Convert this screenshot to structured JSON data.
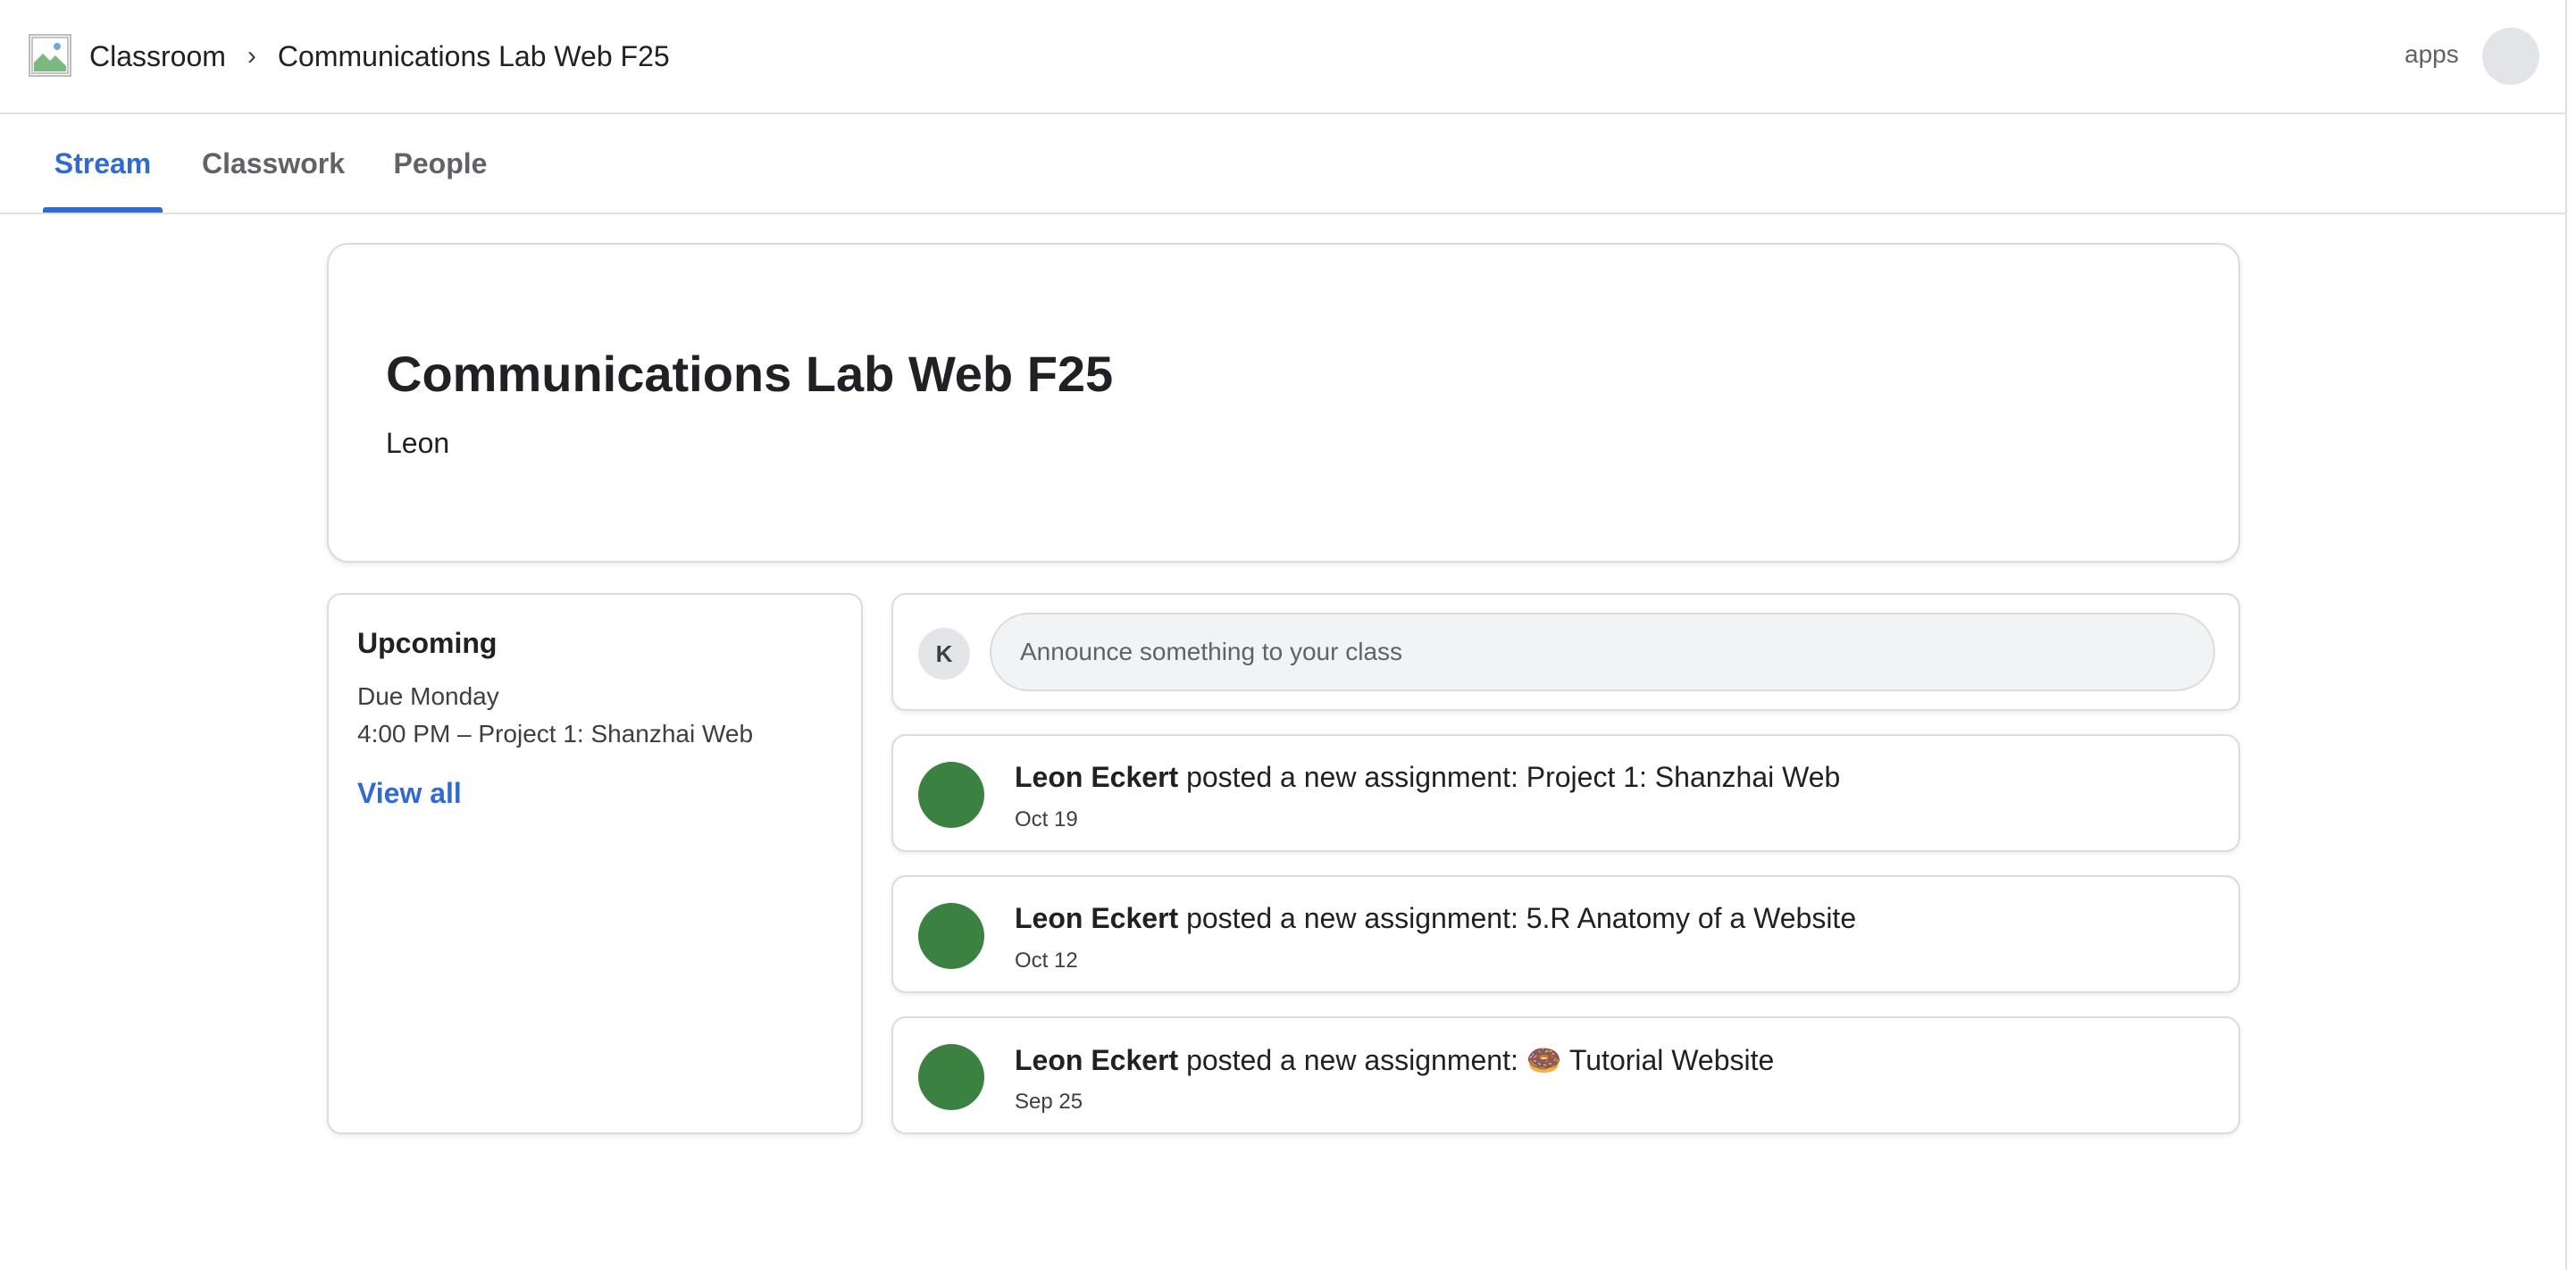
{
  "header": {
    "logo_alt": "",
    "breadcrumb_root": "Classroom",
    "breadcrumb_separator": "›",
    "breadcrumb_current": "Communications Lab Web F25",
    "apps_label": "apps"
  },
  "tabs": [
    {
      "label": "Stream",
      "active": true
    },
    {
      "label": "Classwork",
      "active": false
    },
    {
      "label": "People",
      "active": false
    }
  ],
  "banner": {
    "title": "Communications Lab Web F25",
    "subtitle": "Leon"
  },
  "upcoming": {
    "title": "Upcoming",
    "due_label": "Due Monday",
    "item": "4:00 PM – Project 1: Shanzhai Web",
    "view_all": "View all"
  },
  "announce": {
    "avatar_initial": "K",
    "placeholder": "Announce something to your class"
  },
  "posts": [
    {
      "author": "Leon Eckert",
      "text": " posted a new assignment: Project 1: Shanzhai Web",
      "date": "Oct 19"
    },
    {
      "author": "Leon Eckert",
      "text": " posted a new assignment: 5.R Anatomy of a Website",
      "date": "Oct 12"
    },
    {
      "author": "Leon Eckert",
      "text": " posted a new assignment: 🍩 Tutorial Website",
      "date": "Sep 25"
    }
  ],
  "colors": {
    "accent": "#2f6bd3",
    "post_avatar": "#3b8142",
    "border": "#dadce0"
  }
}
